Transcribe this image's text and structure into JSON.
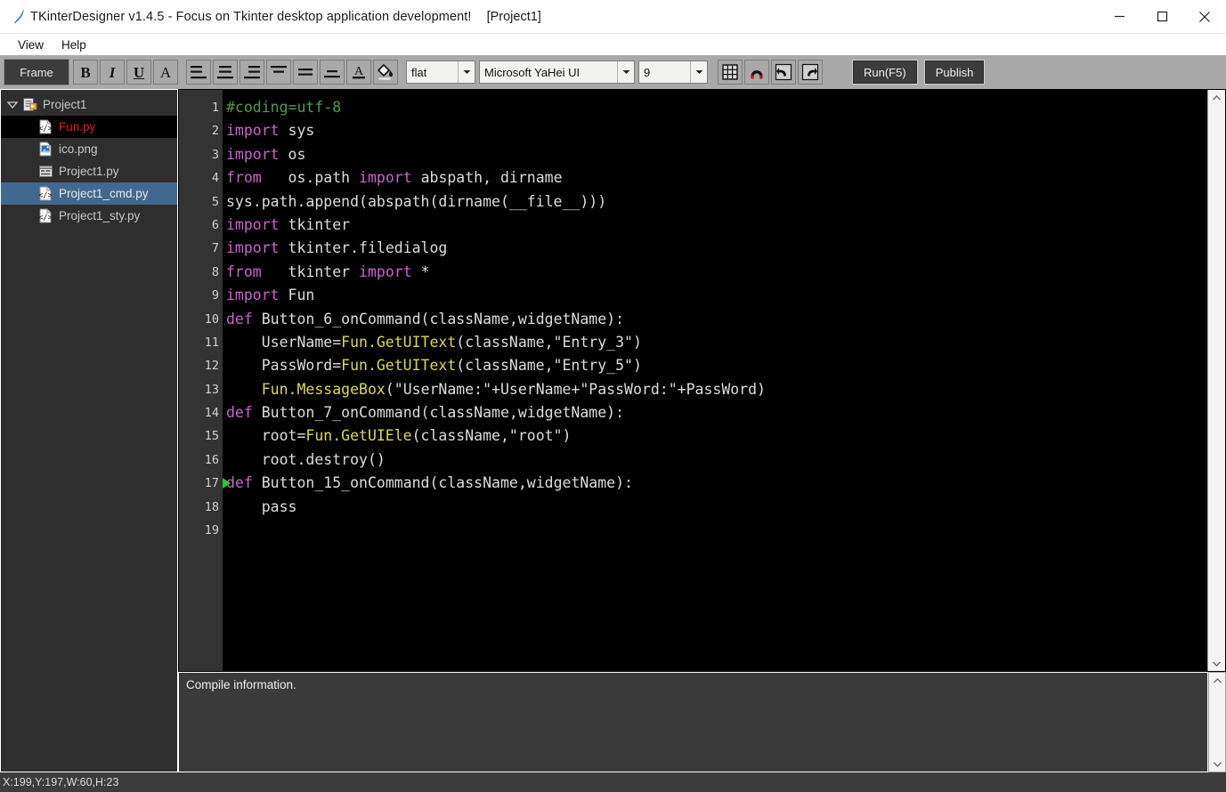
{
  "window": {
    "app_icon": "feather-icon",
    "title": "TKinterDesigner v1.4.5 - Focus on Tkinter desktop application development!",
    "project_tag": "[Project1]",
    "controls": {
      "minimize": "minimize-icon",
      "maximize": "maximize-icon",
      "close": "close-icon"
    }
  },
  "menubar": {
    "items": [
      {
        "label": "View"
      },
      {
        "label": "Help"
      }
    ]
  },
  "toolbar": {
    "widget_type": "Frame",
    "buttons": [
      {
        "name": "bold-button",
        "glyph": "B",
        "style": "b"
      },
      {
        "name": "italic-button",
        "glyph": "I",
        "style": "i"
      },
      {
        "name": "underline-button",
        "glyph": "U",
        "style": "u"
      },
      {
        "name": "font-style-button",
        "glyph": "A",
        "style": "a"
      }
    ],
    "align_buttons": [
      {
        "name": "align-left-button"
      },
      {
        "name": "align-center-button"
      },
      {
        "name": "align-right-button"
      },
      {
        "name": "align-top-button"
      },
      {
        "name": "align-middle-button"
      },
      {
        "name": "align-bottom-button"
      }
    ],
    "fgcolor_button": "A",
    "bgcolor_button": "fill-bucket-icon",
    "relief_combo": {
      "value": "flat"
    },
    "font_combo": {
      "value": "Microsoft YaHei UI"
    },
    "size_combo": {
      "value": "9"
    },
    "tool_icons": [
      {
        "name": "grid-button"
      },
      {
        "name": "magnet-button"
      },
      {
        "name": "undo-button"
      },
      {
        "name": "redo-button"
      }
    ],
    "run_label": "Run(F5)",
    "publish_label": "Publish"
  },
  "tree": {
    "root": {
      "label": "Project1",
      "icon": "project-icon",
      "expanded": true
    },
    "items": [
      {
        "label": "Fun.py",
        "icon": "code-file-icon",
        "color": "red",
        "state": "focused"
      },
      {
        "label": "ico.png",
        "icon": "image-file-icon",
        "color": "gray",
        "state": "normal"
      },
      {
        "label": "Project1.py",
        "icon": "ui-file-icon",
        "color": "gray",
        "state": "normal"
      },
      {
        "label": "Project1_cmd.py",
        "icon": "code-file-icon",
        "color": "white",
        "state": "selected"
      },
      {
        "label": "Project1_sty.py",
        "icon": "code-file-icon",
        "color": "gray",
        "state": "normal"
      }
    ]
  },
  "editor": {
    "current_marker_line": 17,
    "lines": [
      {
        "n": "1",
        "tokens": [
          {
            "t": "#coding=utf-8",
            "c": "com"
          }
        ]
      },
      {
        "n": "2",
        "tokens": [
          {
            "t": "import",
            "c": "kw"
          },
          {
            "t": " sys",
            "c": "pl"
          }
        ]
      },
      {
        "n": "3",
        "tokens": [
          {
            "t": "import",
            "c": "kw"
          },
          {
            "t": " os",
            "c": "pl"
          }
        ]
      },
      {
        "n": "4",
        "tokens": [
          {
            "t": "from",
            "c": "kw"
          },
          {
            "t": "   os.path ",
            "c": "pl"
          },
          {
            "t": "import",
            "c": "kw"
          },
          {
            "t": " abspath, dirname",
            "c": "pl"
          }
        ]
      },
      {
        "n": "5",
        "tokens": [
          {
            "t": "sys.path.append(abspath(dirname(__file__)))",
            "c": "pl"
          }
        ]
      },
      {
        "n": "6",
        "tokens": [
          {
            "t": "import",
            "c": "kw"
          },
          {
            "t": " tkinter",
            "c": "pl"
          }
        ]
      },
      {
        "n": "7",
        "tokens": [
          {
            "t": "import",
            "c": "kw"
          },
          {
            "t": " tkinter.filedialog",
            "c": "pl"
          }
        ]
      },
      {
        "n": "8",
        "tokens": [
          {
            "t": "from",
            "c": "kw"
          },
          {
            "t": "   tkinter ",
            "c": "pl"
          },
          {
            "t": "import",
            "c": "kw"
          },
          {
            "t": " *",
            "c": "pl"
          }
        ]
      },
      {
        "n": "9",
        "tokens": [
          {
            "t": "import",
            "c": "kw"
          },
          {
            "t": " Fun",
            "c": "pl"
          }
        ]
      },
      {
        "n": "10",
        "tokens": [
          {
            "t": "def",
            "c": "kw"
          },
          {
            "t": " Button_6_onCommand(className,widgetName):",
            "c": "pl"
          }
        ]
      },
      {
        "n": "11",
        "tokens": [
          {
            "t": "    UserName=",
            "c": "pl"
          },
          {
            "t": "Fun.GetUIText",
            "c": "fn"
          },
          {
            "t": "(className,\"Entry_3\")",
            "c": "pl"
          }
        ]
      },
      {
        "n": "12",
        "tokens": [
          {
            "t": "    PassWord=",
            "c": "pl"
          },
          {
            "t": "Fun.GetUIText",
            "c": "fn"
          },
          {
            "t": "(className,\"Entry_5\")",
            "c": "pl"
          }
        ]
      },
      {
        "n": "13",
        "tokens": [
          {
            "t": "    ",
            "c": "pl"
          },
          {
            "t": "Fun.MessageBox",
            "c": "fn"
          },
          {
            "t": "(\"UserName:\"+UserName+\"PassWord:\"+PassWord)",
            "c": "pl"
          }
        ]
      },
      {
        "n": "14",
        "tokens": [
          {
            "t": "def",
            "c": "kw"
          },
          {
            "t": " Button_7_onCommand(className,widgetName):",
            "c": "pl"
          }
        ]
      },
      {
        "n": "15",
        "tokens": [
          {
            "t": "    root=",
            "c": "pl"
          },
          {
            "t": "Fun.GetUIEle",
            "c": "fn"
          },
          {
            "t": "(className,\"root\")",
            "c": "pl"
          }
        ]
      },
      {
        "n": "16",
        "tokens": [
          {
            "t": "    root.destroy()",
            "c": "pl"
          }
        ]
      },
      {
        "n": "17",
        "tokens": [
          {
            "t": "def",
            "c": "kw"
          },
          {
            "t": " Button_15_onCommand(className,widgetName):",
            "c": "pl"
          }
        ]
      },
      {
        "n": "18",
        "tokens": [
          {
            "t": "    pass",
            "c": "pl"
          }
        ]
      },
      {
        "n": "19",
        "tokens": []
      }
    ]
  },
  "compile_panel": {
    "text": "Compile information."
  },
  "statusbar": {
    "text": "X:199,Y:197,W:60,H:23"
  },
  "colors": {
    "toolbar_bg": "#a9a9a9",
    "editor_bg": "#000000",
    "gutter_bg": "#333333",
    "panel_bg": "#2e2e2e",
    "selection_blue": "#41688f",
    "keyword": "#cb62cb",
    "comment": "#4e9a4e",
    "function": "#d9d94a",
    "plain": "#dcdcdc",
    "file_red": "#e81717",
    "marker_green": "#22cc22"
  }
}
